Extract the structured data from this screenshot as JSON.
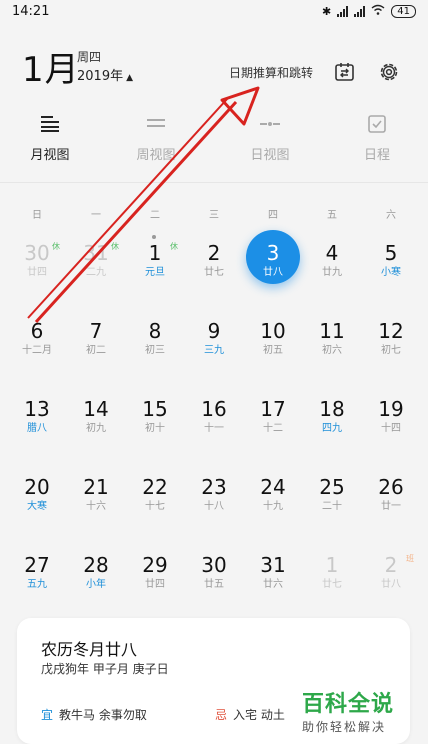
{
  "status": {
    "time": "14:21",
    "battery": "41"
  },
  "header": {
    "month": "1月",
    "weekday": "周四",
    "year": "2019年",
    "jump_link": "日期推算和跳转",
    "icons": [
      "calendar-jump-icon",
      "gear-icon"
    ]
  },
  "tabs": [
    {
      "label": "月视图",
      "icon": "month-view-icon",
      "active": true
    },
    {
      "label": "周视图",
      "icon": "week-view-icon",
      "active": false
    },
    {
      "label": "日视图",
      "icon": "day-view-icon",
      "active": false
    },
    {
      "label": "日程",
      "icon": "schedule-icon",
      "active": false
    }
  ],
  "weekdays": [
    "日",
    "一",
    "二",
    "三",
    "四",
    "五",
    "六"
  ],
  "weeks": [
    [
      {
        "n": "30",
        "l": "廿四",
        "dim": true,
        "badge": "休"
      },
      {
        "n": "31",
        "l": "二九",
        "dim": true,
        "badge": "休"
      },
      {
        "n": "1",
        "l": "元旦",
        "accent": true,
        "badge": "休",
        "dot": true
      },
      {
        "n": "2",
        "l": "廿七"
      },
      {
        "n": "3",
        "l": "廿八",
        "today": true
      },
      {
        "n": "4",
        "l": "廿九"
      },
      {
        "n": "5",
        "l": "小寒",
        "accent": true
      }
    ],
    [
      {
        "n": "6",
        "l": "十二月"
      },
      {
        "n": "7",
        "l": "初二"
      },
      {
        "n": "8",
        "l": "初三"
      },
      {
        "n": "9",
        "l": "三九",
        "accent": true
      },
      {
        "n": "10",
        "l": "初五"
      },
      {
        "n": "11",
        "l": "初六"
      },
      {
        "n": "12",
        "l": "初七"
      }
    ],
    [
      {
        "n": "13",
        "l": "腊八",
        "accent": true
      },
      {
        "n": "14",
        "l": "初九"
      },
      {
        "n": "15",
        "l": "初十"
      },
      {
        "n": "16",
        "l": "十一"
      },
      {
        "n": "17",
        "l": "十二"
      },
      {
        "n": "18",
        "l": "四九",
        "accent": true
      },
      {
        "n": "19",
        "l": "十四"
      }
    ],
    [
      {
        "n": "20",
        "l": "大寒",
        "accent": true
      },
      {
        "n": "21",
        "l": "十六"
      },
      {
        "n": "22",
        "l": "十七"
      },
      {
        "n": "23",
        "l": "十八"
      },
      {
        "n": "24",
        "l": "十九"
      },
      {
        "n": "25",
        "l": "二十"
      },
      {
        "n": "26",
        "l": "廿一"
      }
    ],
    [
      {
        "n": "27",
        "l": "五九",
        "accent": true
      },
      {
        "n": "28",
        "l": "小年",
        "accent": true
      },
      {
        "n": "29",
        "l": "廿四"
      },
      {
        "n": "30",
        "l": "廿五"
      },
      {
        "n": "31",
        "l": "廿六"
      },
      {
        "n": "1",
        "l": "廿七",
        "dim": true
      },
      {
        "n": "2",
        "l": "廿八",
        "dim": true,
        "badge": "班",
        "badge_orange": true
      }
    ]
  ],
  "card": {
    "title": "农历冬月廿八",
    "subtitle": "戊戌狗年 甲子月 庚子日",
    "yi_tag": "宜",
    "yi_text": "教牛马 余事勿取",
    "ji_tag": "忌",
    "ji_text": "入宅 动土"
  },
  "watermark": {
    "main": "百科全说",
    "sub": "助你轻松解决"
  },
  "colors": {
    "accent": "#1c8fe6",
    "holiday": "#5bbf6b",
    "workday": "#f3b48b",
    "arrow": "#d8231f",
    "watermark": "#2ea84a"
  }
}
